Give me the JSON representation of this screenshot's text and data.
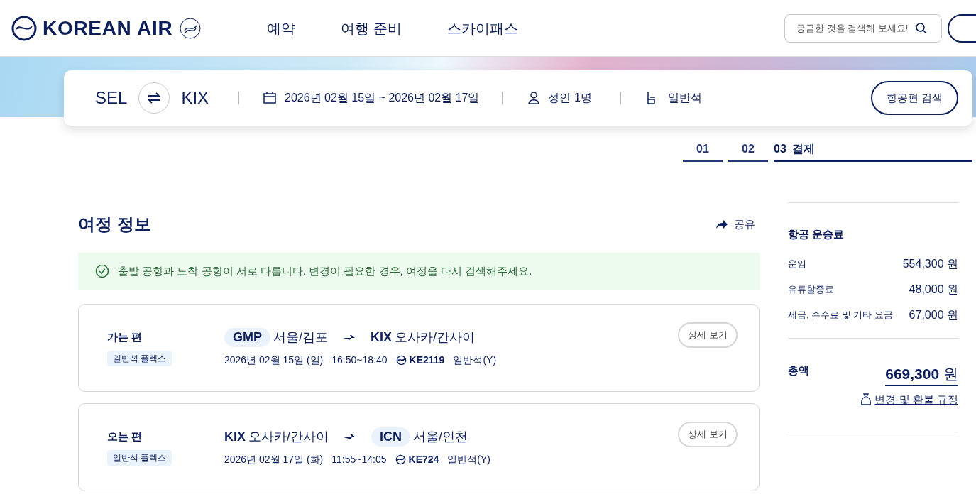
{
  "header": {
    "logo": "KOREAN AIR",
    "nav": [
      "예약",
      "여행 준비",
      "스카이패스"
    ],
    "search": {
      "placeholder": "궁금한 것을 검색해 보세요!"
    }
  },
  "search_bar": {
    "origin": "SEL",
    "destination": "KIX",
    "dates": "2026년 02월 15일 ~ 2026년 02월 17일",
    "passengers": "성인 1명",
    "cabin": "일반석",
    "button": "항공편 검색"
  },
  "steps": [
    {
      "number": "01",
      "selected": false
    },
    {
      "number": "02",
      "selected": false
    },
    {
      "number": "03",
      "label": "결제",
      "selected": true
    }
  ],
  "itinerary": {
    "title": "여정 정보",
    "share": "공유",
    "notice": "출발 공항과 도착 공항이 서로 다릅니다. 변경이 필요한 경우, 여정을 다시 검색해주세요.",
    "flights": [
      {
        "label": "가는 편",
        "fare": "일반석 플렉스",
        "from": {
          "code": "GMP",
          "city": "서울/김포",
          "highlighted": true
        },
        "to": {
          "code": "KIX",
          "city": "오사카/간사이",
          "highlighted": false
        },
        "date": "2026년 02월 15일 (일)",
        "time": "16:50~18:40",
        "flight_no": "KE2119",
        "cabin": "일반석(Y)",
        "button": "상세 보기"
      },
      {
        "label": "오는 편",
        "fare": "일반석 플렉스",
        "from": {
          "code": "KIX",
          "city": "오사카/간사이",
          "highlighted": false
        },
        "to": {
          "code": "ICN",
          "city": "서울/인천",
          "highlighted": true
        },
        "date": "2026년 02월 17일 (화)",
        "time": "11:55~14:05",
        "flight_no": "KE724",
        "cabin": "일반석(Y)",
        "button": "상세 보기"
      }
    ]
  },
  "fare": {
    "title": "항공 운송료",
    "items": [
      {
        "label": "운임",
        "amount": "554,300 원"
      },
      {
        "label": "유류할증료",
        "amount": "48,000 원"
      },
      {
        "label": "세금, 수수료 및 기타 요금",
        "amount": "67,000 원"
      }
    ],
    "total_label": "총액",
    "total": "**669,300** 원",
    "rules_link": "변경 및 환불 규정"
  }
}
